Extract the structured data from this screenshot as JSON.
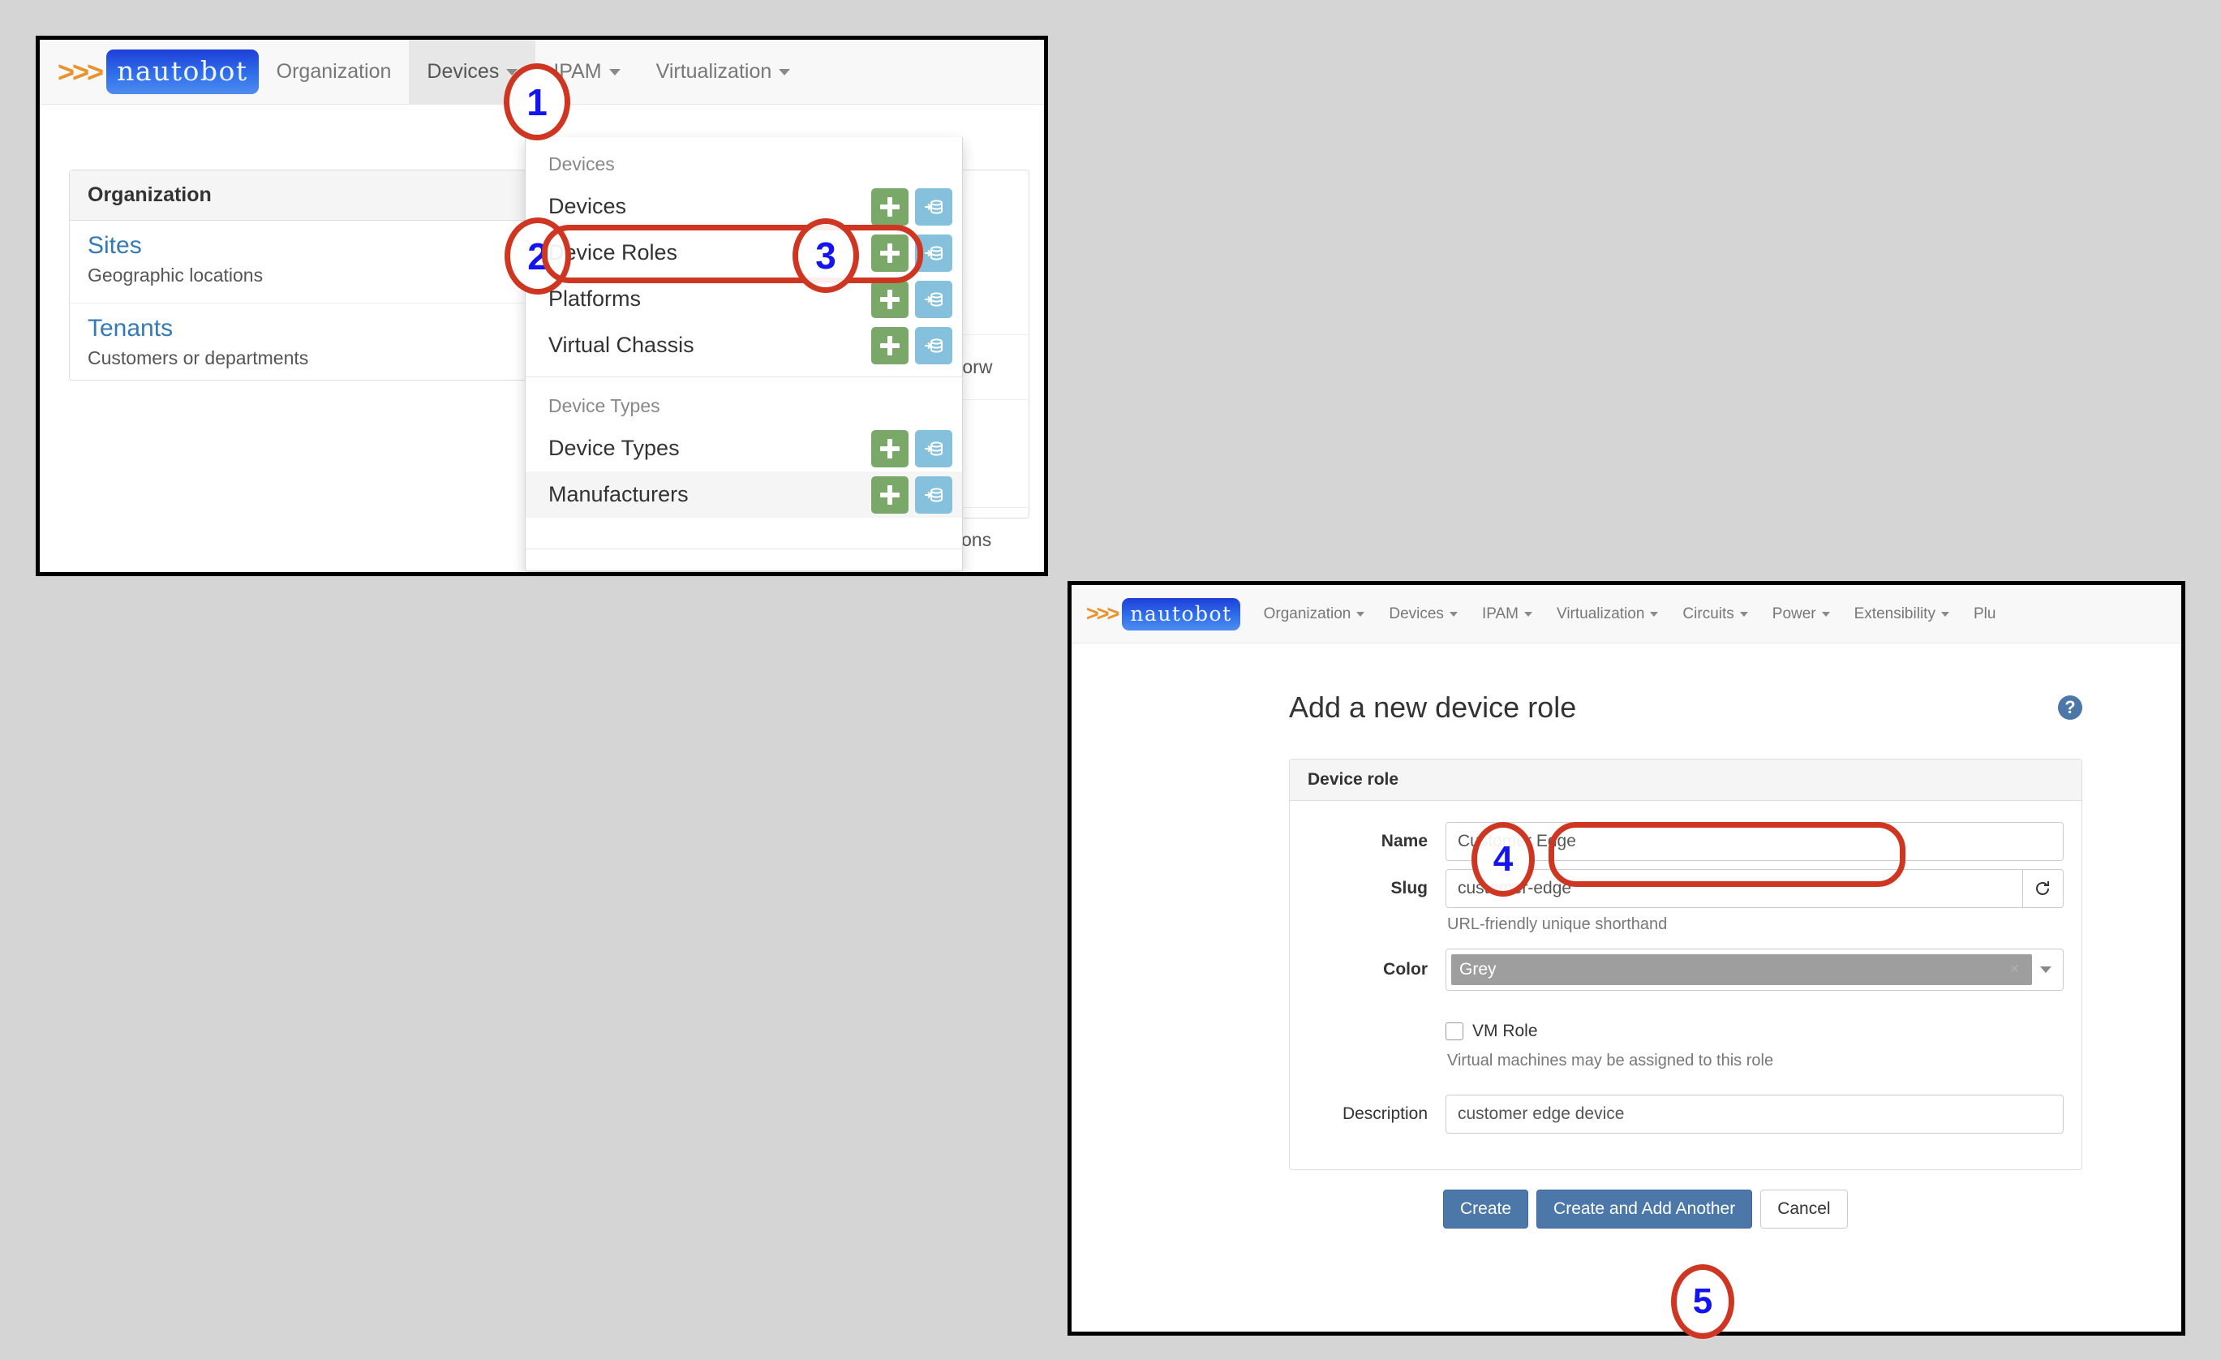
{
  "app": {
    "brand_chevrons": ">>>",
    "brand_name": "nautobot"
  },
  "window1": {
    "navbar": {
      "items": [
        {
          "label": "Organization",
          "has_caret": false,
          "active": false
        },
        {
          "label": "Devices",
          "has_caret": true,
          "active": true
        },
        {
          "label": "IPAM",
          "has_caret": true,
          "active": false
        },
        {
          "label": "Virtualization",
          "has_caret": true,
          "active": false
        }
      ]
    },
    "organization_panel": {
      "header": "Organization",
      "rows": [
        {
          "link": "Sites",
          "description": "Geographic locations"
        },
        {
          "link": "Tenants",
          "description": "Customers or departments"
        }
      ]
    },
    "ghost_panel": {
      "rows": [
        "forw",
        "ions"
      ]
    },
    "devices_menu": {
      "groups": [
        {
          "header": "Devices",
          "items": [
            {
              "label": "Devices",
              "add_icon": "plus-icon",
              "import_icon": "database-import-icon"
            },
            {
              "label": "Device Roles",
              "add_icon": "plus-icon",
              "import_icon": "database-import-icon"
            },
            {
              "label": "Platforms",
              "add_icon": "plus-icon",
              "import_icon": "database-import-icon"
            },
            {
              "label": "Virtual Chassis",
              "add_icon": "plus-icon",
              "import_icon": "database-import-icon"
            }
          ]
        },
        {
          "header": "Device Types",
          "items": [
            {
              "label": "Device Types",
              "add_icon": "plus-icon",
              "import_icon": "database-import-icon"
            },
            {
              "label": "Manufacturers",
              "add_icon": "plus-icon",
              "import_icon": "database-import-icon"
            }
          ]
        }
      ]
    }
  },
  "window2": {
    "navbar": {
      "items": [
        {
          "label": "Organization",
          "has_caret": true
        },
        {
          "label": "Devices",
          "has_caret": true
        },
        {
          "label": "IPAM",
          "has_caret": true
        },
        {
          "label": "Virtualization",
          "has_caret": true
        },
        {
          "label": "Circuits",
          "has_caret": true
        },
        {
          "label": "Power",
          "has_caret": true
        },
        {
          "label": "Extensibility",
          "has_caret": true
        },
        {
          "label": "Plu",
          "has_caret": false
        }
      ]
    },
    "page_title": "Add a new device role",
    "help_icon": "question-mark-icon",
    "form": {
      "card_header": "Device role",
      "name": {
        "label": "Name",
        "value": "Customer Edge"
      },
      "slug": {
        "label": "Slug",
        "value": "customer-edge",
        "help": "URL-friendly unique shorthand",
        "refresh_icon": "refresh-icon"
      },
      "color": {
        "label": "Color",
        "value": "Grey",
        "clear_glyph": "×",
        "swatch_hex": "#9e9e9e"
      },
      "vm_role": {
        "label": "VM Role",
        "checked": false,
        "help": "Virtual machines may be assigned to this role"
      },
      "description": {
        "label": "Description",
        "value": "customer edge device"
      }
    },
    "buttons": {
      "create": "Create",
      "create_and_add_another": "Create and Add Another",
      "cancel": "Cancel"
    }
  },
  "annotations": {
    "accent_hex": "#cf3622",
    "number_hex": "#1414ef",
    "steps": [
      {
        "id": "1",
        "shape": "ellipse"
      },
      {
        "id": "2",
        "shape": "ellipse"
      },
      {
        "id": "3",
        "shape": "ellipse"
      },
      {
        "id": "4",
        "shape": "ellipse"
      },
      {
        "id": "5",
        "shape": "ellipse"
      }
    ]
  }
}
